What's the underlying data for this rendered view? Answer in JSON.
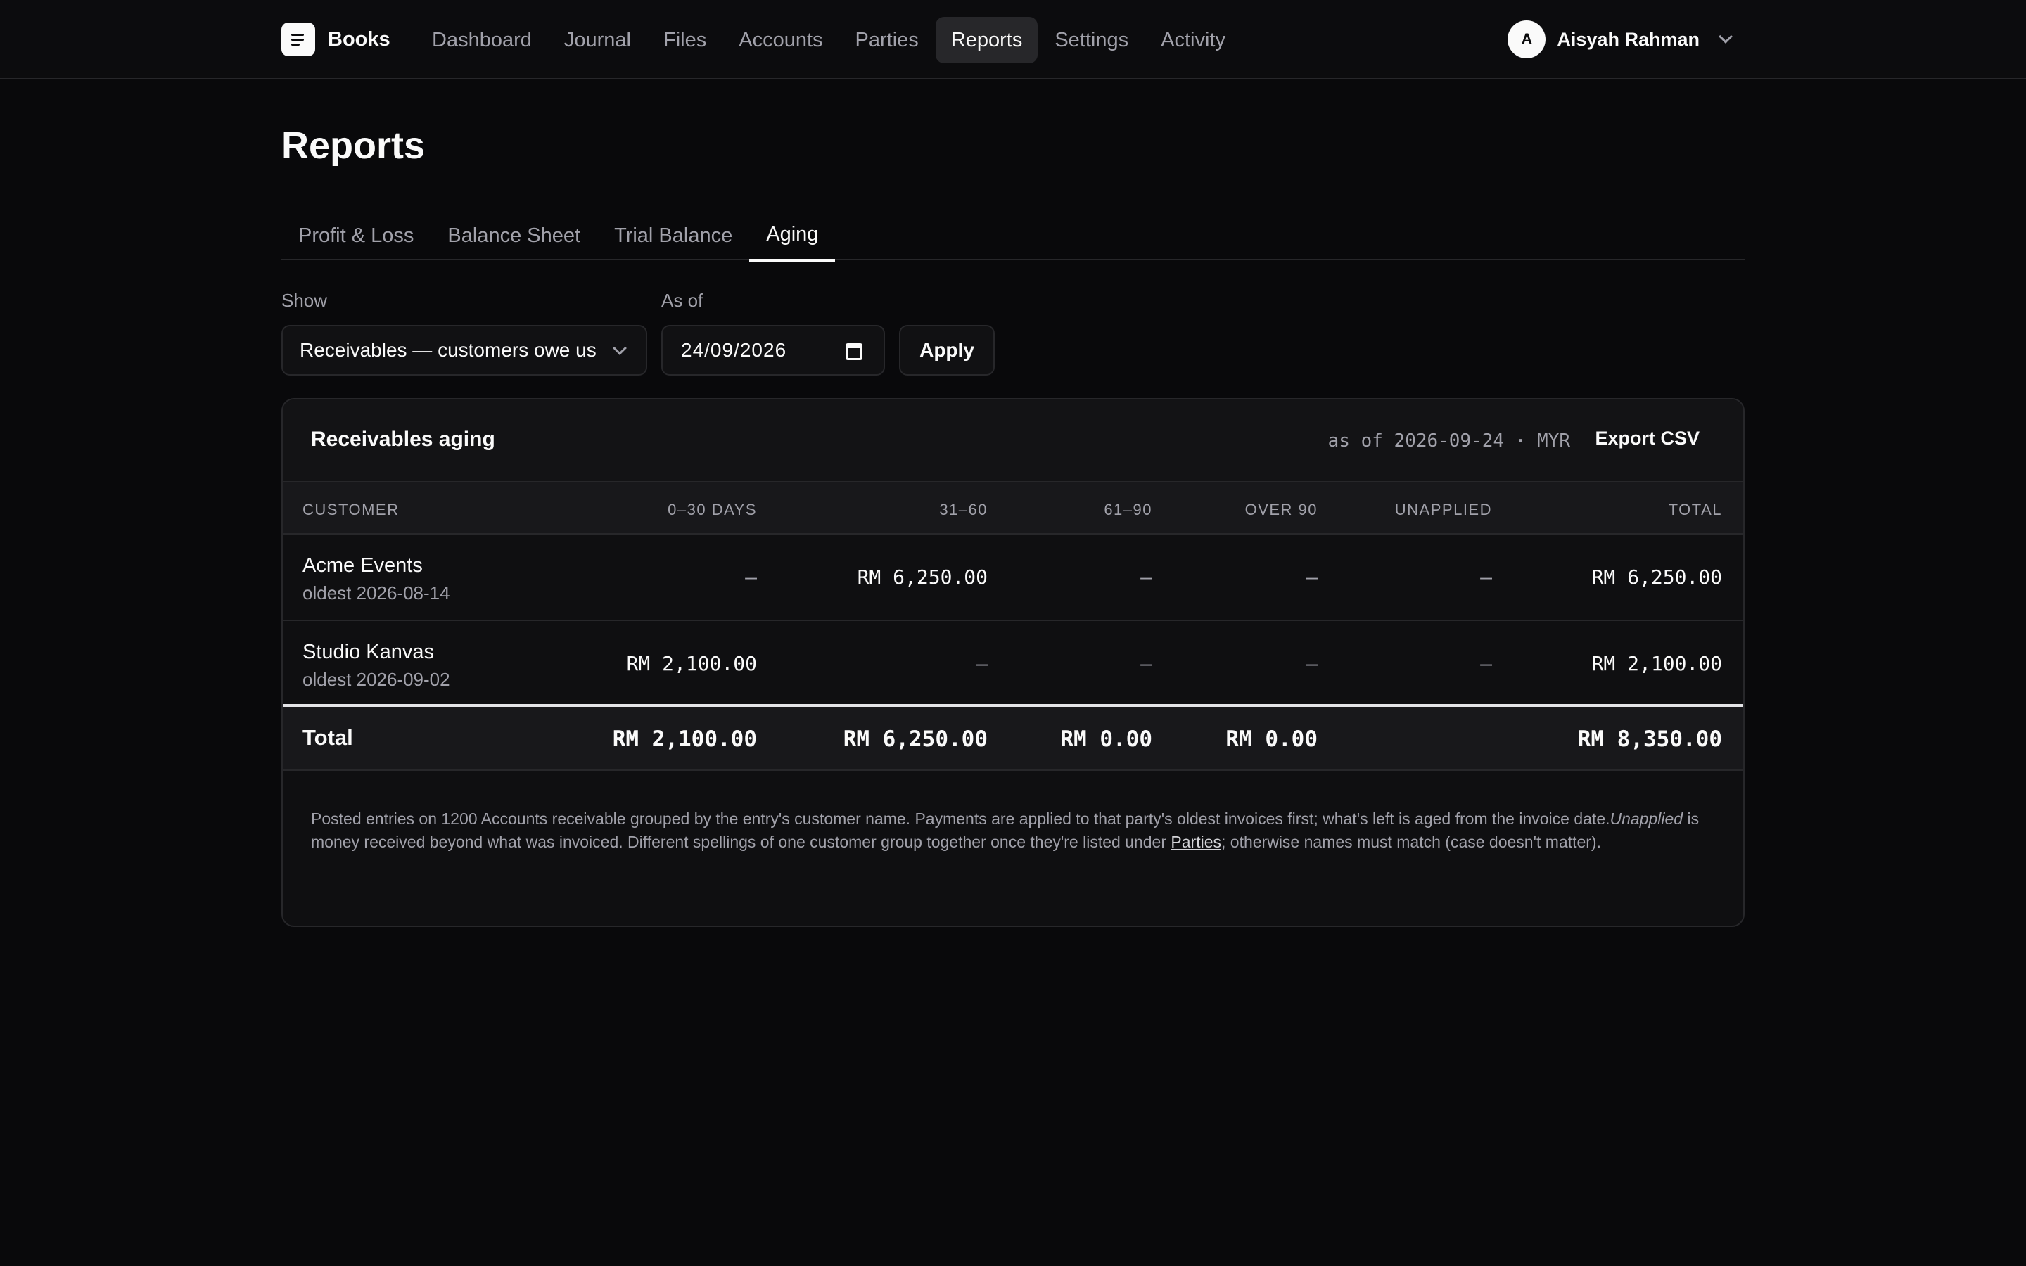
{
  "header": {
    "brand": "Books",
    "nav": [
      "Dashboard",
      "Journal",
      "Files",
      "Accounts",
      "Parties",
      "Reports",
      "Settings",
      "Activity"
    ],
    "active_nav": "Reports",
    "user": {
      "initial": "A",
      "name": "Aisyah Rahman"
    }
  },
  "page": {
    "title": "Reports",
    "tabs": [
      "Profit & Loss",
      "Balance Sheet",
      "Trial Balance",
      "Aging"
    ],
    "active_tab": "Aging"
  },
  "filters": {
    "show_label": "Show",
    "show_value": "Receivables — customers owe us",
    "asof_label": "As of",
    "asof_value": "24/09/2026",
    "apply_label": "Apply"
  },
  "report": {
    "title": "Receivables aging",
    "meta": "as of 2026-09-24 · MYR",
    "export_label": "Export CSV",
    "columns": [
      "CUSTOMER",
      "0–30 DAYS",
      "31–60",
      "61–90",
      "OVER 90",
      "UNAPPLIED",
      "TOTAL"
    ],
    "rows": [
      {
        "customer": "Acme Events",
        "oldest": "oldest 2026-08-14",
        "d0_30": "–",
        "d31_60": "RM 6,250.00",
        "d61_90": "–",
        "over90": "–",
        "unapplied": "–",
        "total": "RM 6,250.00"
      },
      {
        "customer": "Studio Kanvas",
        "oldest": "oldest 2026-09-02",
        "d0_30": "RM 2,100.00",
        "d31_60": "–",
        "d61_90": "–",
        "over90": "–",
        "unapplied": "–",
        "total": "RM 2,100.00"
      }
    ],
    "totals": {
      "label": "Total",
      "d0_30": "RM 2,100.00",
      "d31_60": "RM 6,250.00",
      "d61_90": "RM 0.00",
      "over90": "RM 0.00",
      "unapplied": "",
      "total": "RM 8,350.00"
    },
    "note": {
      "part1": "Posted entries on 1200 Accounts receivable grouped by the entry's customer name. Payments are applied to that party's oldest invoices first; what's left is aged from the invoice date.",
      "italic": "Unapplied",
      "part2": " is money received beyond what was invoiced. Different spellings of one customer group together once they're listed under ",
      "link": "Parties",
      "part3": "; otherwise names must match (case doesn't matter)."
    }
  }
}
